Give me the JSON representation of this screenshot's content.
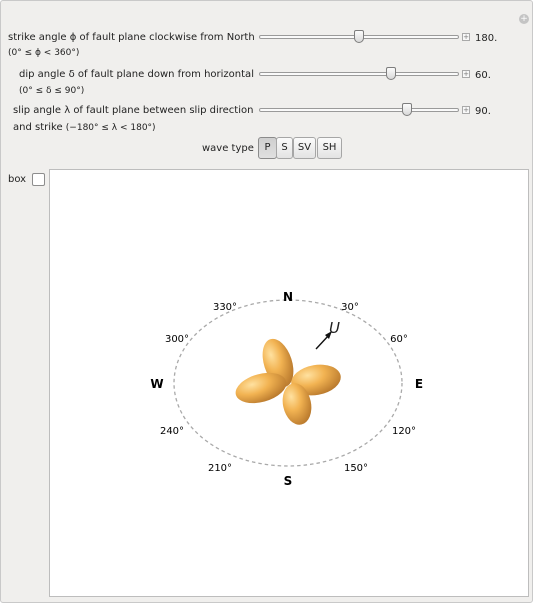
{
  "controls": {
    "strike": {
      "label": "strike angle ϕ of fault plane clockwise from North",
      "range": "(0° ≤ ϕ < 360°)",
      "value": "180.",
      "fraction": 0.5
    },
    "dip": {
      "label": "dip angle δ of fault plane down from horizontal",
      "range": "(0° ≤ δ ≤ 90°)",
      "value": "60.",
      "fraction": 0.667
    },
    "slip": {
      "label": "slip angle λ of fault plane between slip direction",
      "label2": "and strike",
      "range": "(−180° ≤ λ < 180°)",
      "value": "90.",
      "fraction": 0.75
    }
  },
  "wave_type": {
    "label": "wave type",
    "options": [
      "P",
      "S",
      "SV",
      "SH"
    ],
    "selected": "P"
  },
  "box": {
    "label": "box",
    "checked": false
  },
  "plot": {
    "cardinals": {
      "north": "N",
      "east": "E",
      "south": "S",
      "west": "W"
    },
    "angles": {
      "a30": "30°",
      "a60": "60°",
      "a120": "120°",
      "a150": "150°",
      "a210": "210°",
      "a240": "240°",
      "a300": "300°",
      "a330": "330°"
    },
    "vector_label": "U",
    "lobe_color": "#f2b352"
  }
}
